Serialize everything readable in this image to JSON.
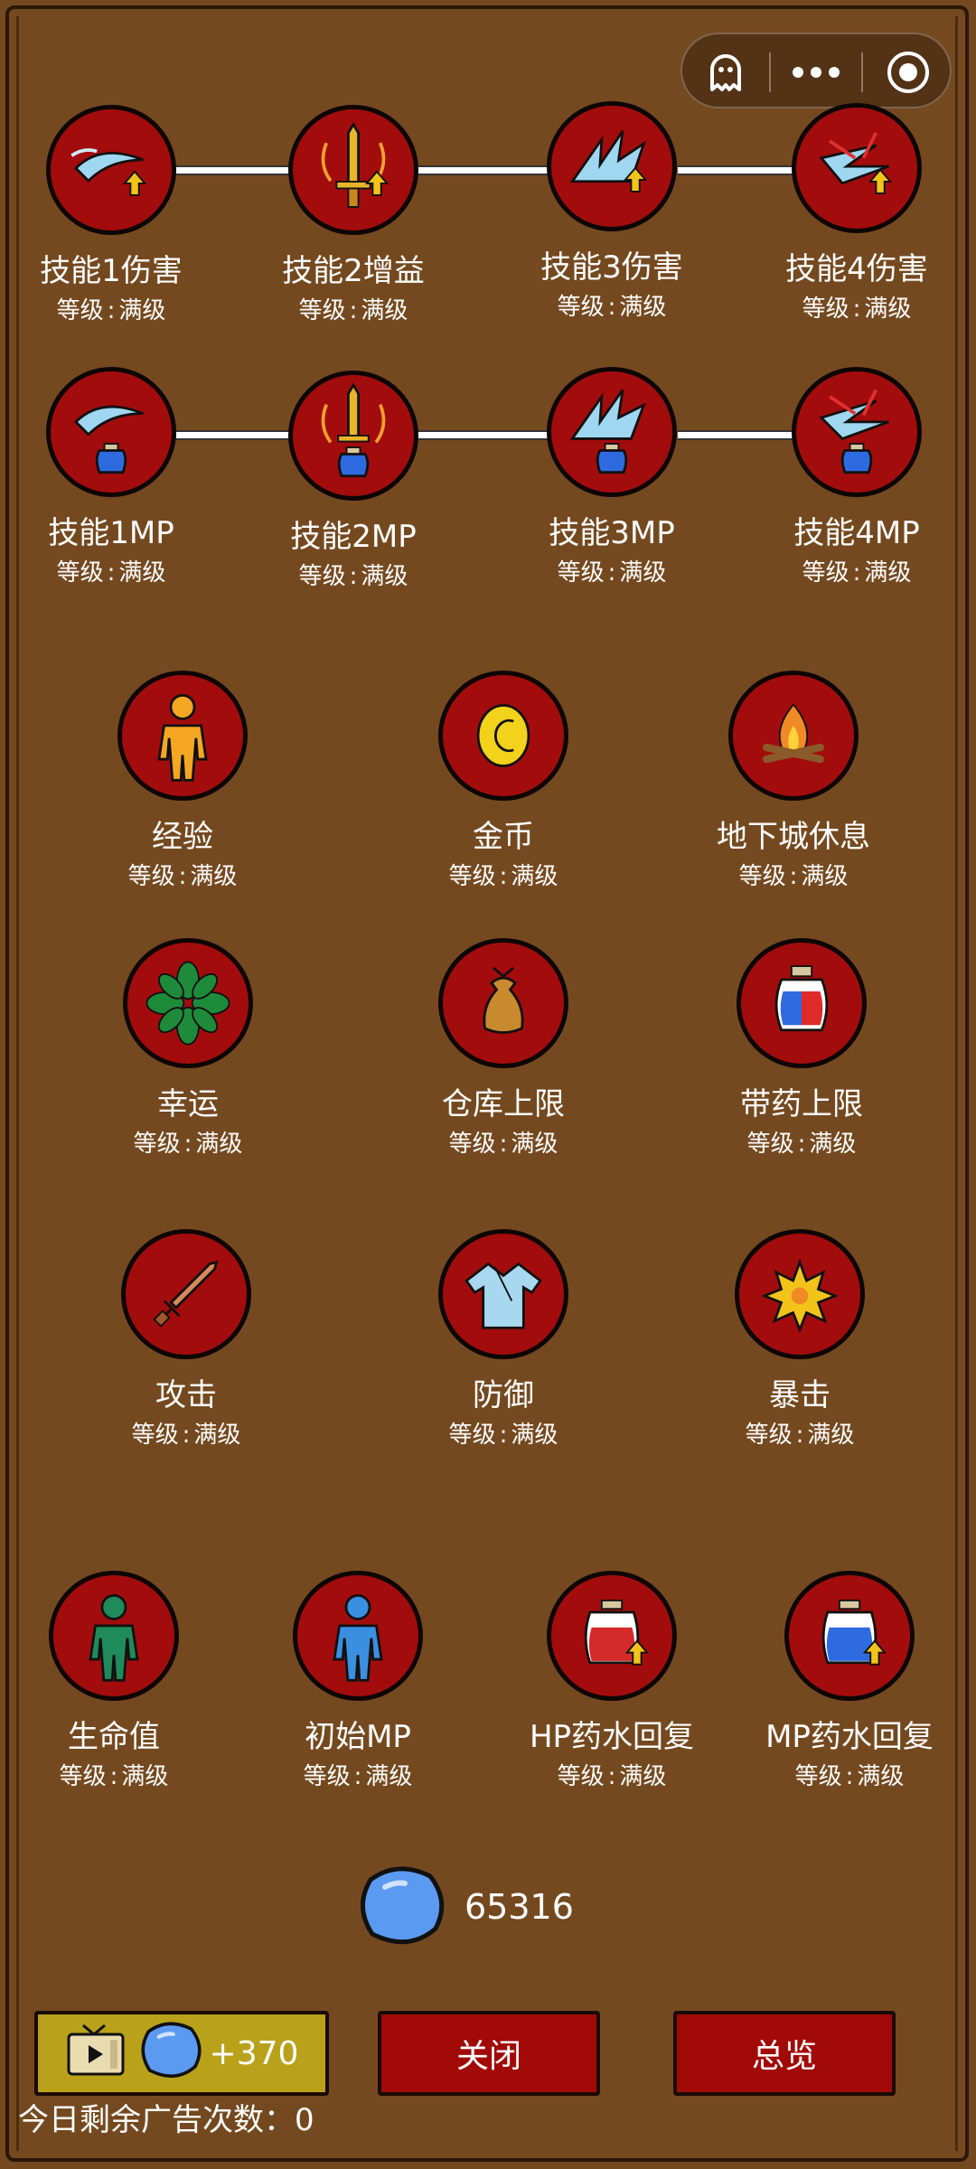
{
  "capsule": {
    "icons": [
      "ghost-icon",
      "more-icon",
      "target-icon"
    ]
  },
  "level_label": "等级",
  "level_colon": ":",
  "skill_rows": {
    "row1": [
      {
        "name": "技能1伤害",
        "level": "满级",
        "icon": "wind-slash-up-icon"
      },
      {
        "name": "技能2增益",
        "level": "满级",
        "icon": "sword-up-icon"
      },
      {
        "name": "技能3伤害",
        "level": "满级",
        "icon": "spike-burst-up-icon"
      },
      {
        "name": "技能4伤害",
        "level": "满级",
        "icon": "multi-slash-up-icon"
      }
    ],
    "row2": [
      {
        "name": "技能1MP",
        "level": "满级",
        "icon": "wind-slash-potion-icon"
      },
      {
        "name": "技能2MP",
        "level": "满级",
        "icon": "sword-potion-icon"
      },
      {
        "name": "技能3MP",
        "level": "满级",
        "icon": "spike-burst-potion-icon"
      },
      {
        "name": "技能4MP",
        "level": "满级",
        "icon": "multi-slash-potion-icon"
      }
    ],
    "row3": [
      {
        "name": "经验",
        "level": "满级",
        "icon": "person-icon"
      },
      {
        "name": "金币",
        "level": "满级",
        "icon": "coin-icon"
      },
      {
        "name": "地下城休息",
        "level": "满级",
        "icon": "campfire-icon"
      }
    ],
    "row4": [
      {
        "name": "幸运",
        "level": "满级",
        "icon": "clover-icon"
      },
      {
        "name": "仓库上限",
        "level": "满级",
        "icon": "sack-icon"
      },
      {
        "name": "带药上限",
        "level": "满级",
        "icon": "potion-jar-icon"
      }
    ],
    "row5": [
      {
        "name": "攻击",
        "level": "满级",
        "icon": "sword-icon"
      },
      {
        "name": "防御",
        "level": "满级",
        "icon": "robe-icon"
      },
      {
        "name": "暴击",
        "level": "满级",
        "icon": "explosion-icon"
      }
    ],
    "row6": [
      {
        "name": "生命值",
        "level": "满级",
        "icon": "person-green-icon"
      },
      {
        "name": "初始MP",
        "level": "满级",
        "icon": "person-blue-icon"
      },
      {
        "name": "HP药水回复",
        "level": "满级",
        "icon": "hp-potion-up-icon"
      },
      {
        "name": "MP药水回复",
        "level": "满级",
        "icon": "mp-potion-up-icon"
      }
    ]
  },
  "currency": {
    "value": "65316",
    "icon": "blue-gem-icon"
  },
  "buttons": {
    "ad_reward": "+370",
    "close": "关闭",
    "overview": "总览"
  },
  "ad_remaining": "今日剩余广告次数：0",
  "colors": {
    "background": "#75491f",
    "icon_bg": "#a30c0c",
    "button_red": "#a20a07",
    "button_ad": "#b9a21a"
  }
}
